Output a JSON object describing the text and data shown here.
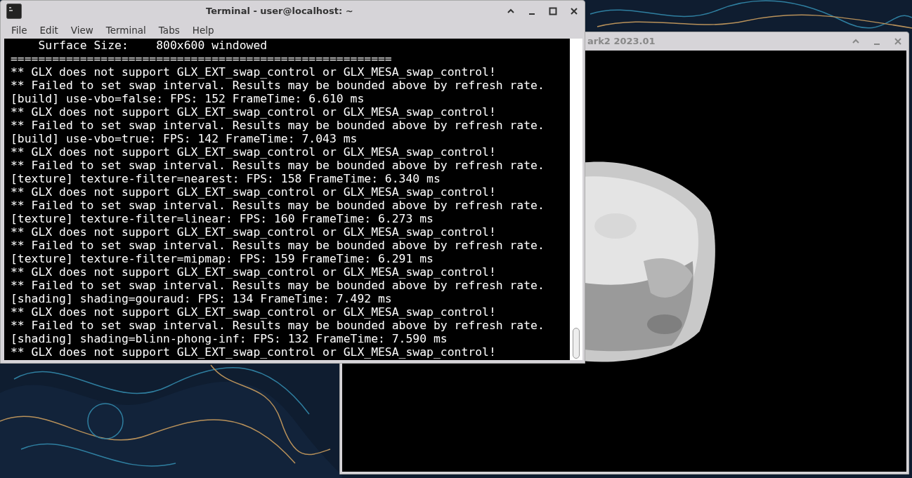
{
  "render_window": {
    "title": "ark2 2023.01"
  },
  "terminal": {
    "title": "Terminal - user@localhost: ~",
    "menu": [
      "File",
      "Edit",
      "View",
      "Terminal",
      "Tabs",
      "Help"
    ],
    "lines": [
      "    Surface Size:    800x600 windowed",
      "=======================================================",
      "** GLX does not support GLX_EXT_swap_control or GLX_MESA_swap_control!",
      "** Failed to set swap interval. Results may be bounded above by refresh rate.",
      "[build] use-vbo=false: FPS: 152 FrameTime: 6.610 ms",
      "** GLX does not support GLX_EXT_swap_control or GLX_MESA_swap_control!",
      "** Failed to set swap interval. Results may be bounded above by refresh rate.",
      "[build] use-vbo=true: FPS: 142 FrameTime: 7.043 ms",
      "** GLX does not support GLX_EXT_swap_control or GLX_MESA_swap_control!",
      "** Failed to set swap interval. Results may be bounded above by refresh rate.",
      "[texture] texture-filter=nearest: FPS: 158 FrameTime: 6.340 ms",
      "** GLX does not support GLX_EXT_swap_control or GLX_MESA_swap_control!",
      "** Failed to set swap interval. Results may be bounded above by refresh rate.",
      "[texture] texture-filter=linear: FPS: 160 FrameTime: 6.273 ms",
      "** GLX does not support GLX_EXT_swap_control or GLX_MESA_swap_control!",
      "** Failed to set swap interval. Results may be bounded above by refresh rate.",
      "[texture] texture-filter=mipmap: FPS: 159 FrameTime: 6.291 ms",
      "** GLX does not support GLX_EXT_swap_control or GLX_MESA_swap_control!",
      "** Failed to set swap interval. Results may be bounded above by refresh rate.",
      "[shading] shading=gouraud: FPS: 134 FrameTime: 7.492 ms",
      "** GLX does not support GLX_EXT_swap_control or GLX_MESA_swap_control!",
      "** Failed to set swap interval. Results may be bounded above by refresh rate.",
      "[shading] shading=blinn-phong-inf: FPS: 132 FrameTime: 7.590 ms",
      "** GLX does not support GLX_EXT_swap_control or GLX_MESA_swap_control!"
    ]
  }
}
